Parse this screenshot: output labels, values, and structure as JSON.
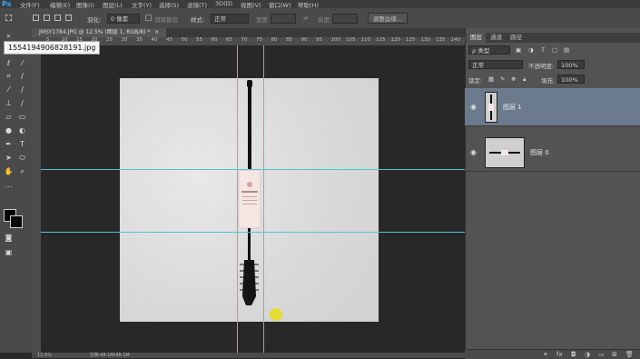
{
  "app": {
    "logo": "Ps"
  },
  "menu": [
    "文件(F)",
    "编辑(E)",
    "图像(I)",
    "图层(L)",
    "文字(Y)",
    "选择(S)",
    "滤镜(T)",
    "3D(D)",
    "视图(V)",
    "窗口(W)",
    "帮助(H)"
  ],
  "options": {
    "feather_label": "羽化:",
    "feather_value": "0 像素",
    "antialias_label": "消除锯齿",
    "style_label": "样式:",
    "style_value": "正常",
    "width_label": "宽度:",
    "height_label": "高度:",
    "refine_edge_button": "调整边缘..."
  },
  "document": {
    "tab_title": "JMSY1784.JPG @ 12.5% (图层 1, RGB/8) *",
    "tab_close": "×",
    "ruler_ticks": [
      "5",
      "10",
      "15",
      "20",
      "25",
      "30",
      "35",
      "40",
      "45",
      "50",
      "55",
      "60",
      "65",
      "70",
      "75",
      "80",
      "85",
      "90",
      "95",
      "100",
      "105",
      "110",
      "115",
      "120",
      "125",
      "130",
      "135",
      "140"
    ]
  },
  "tooltip": {
    "filename": "15541949068281​91.jpg"
  },
  "status": {
    "zoom": "12.5%",
    "doc_info": "文档:48.1M/48.1M"
  },
  "panel": {
    "tabs": [
      "图层",
      "通道",
      "路径"
    ],
    "kind_filter": "ρ 类型",
    "blend_mode": "正常",
    "opacity_label": "不透明度:",
    "opacity_value": "100%",
    "lock_label": "锁定:",
    "fill_label": "填充:",
    "fill_value": "100%",
    "layers": [
      {
        "name": "图层 1",
        "selected": true
      },
      {
        "name": "图层 0",
        "selected": false
      }
    ]
  },
  "colors": {
    "guide": "#4fc3d6",
    "selection": "#6c7a8d",
    "cursor_highlight": "#e6dc33"
  },
  "icons": [
    "marquee-icon",
    "move-icon",
    "lasso-icon",
    "magic-wand-icon",
    "crop-icon",
    "eyedropper-icon",
    "brush-icon",
    "stamp-icon",
    "history-brush-icon",
    "eraser-icon",
    "gradient-icon",
    "blur-icon",
    "dodge-icon",
    "pen-icon",
    "type-icon",
    "path-select-icon",
    "shape-icon",
    "hand-icon",
    "zoom-icon",
    "eye-icon"
  ]
}
